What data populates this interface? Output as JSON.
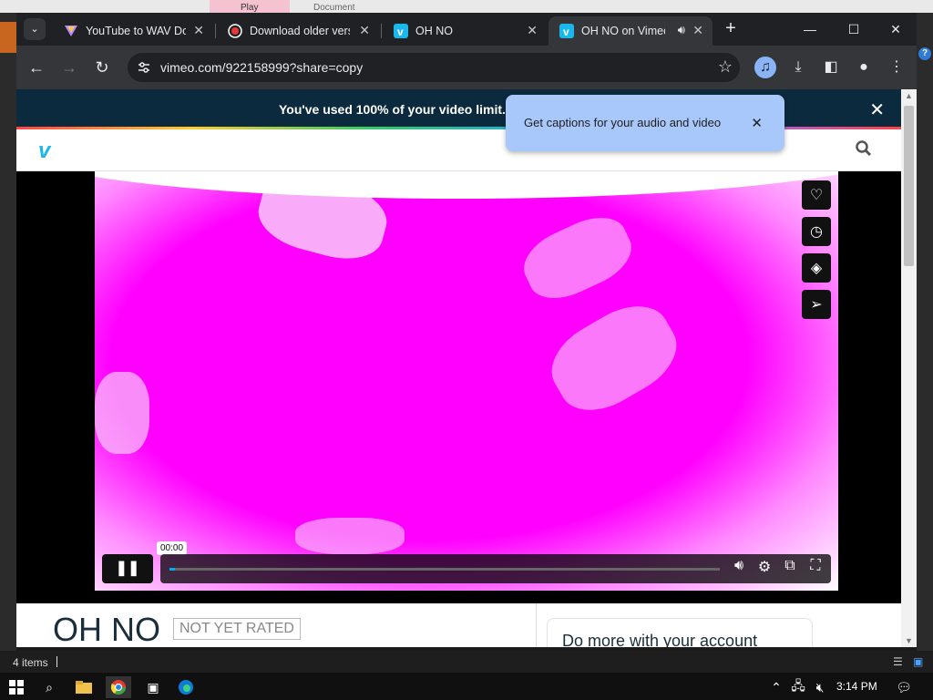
{
  "desktop": {
    "bg_label_1": "Play",
    "bg_label_2": "Document"
  },
  "tabs": [
    {
      "title": "YouTube to WAV Dow",
      "icon": "triangle-logo-icon"
    },
    {
      "title": "Download older vers",
      "icon": "record-icon"
    },
    {
      "title": "OH NO",
      "icon": "vimeo-icon"
    },
    {
      "title": "OH NO on Vimeo",
      "icon": "vimeo-icon",
      "active": true
    }
  ],
  "tab_search_label": "⌄",
  "new_tab_label": "+",
  "window_controls": {
    "minimize": "—",
    "maximize": "☐",
    "close": "✕"
  },
  "toolbar": {
    "url": "vimeo.com/922158999?share=copy",
    "back": "←",
    "forward": "→",
    "reload": "↻"
  },
  "banner": {
    "text": "You've used 100% of your video limit.",
    "close": "✕"
  },
  "captions_popup": {
    "text": "Get captions for your audio and video",
    "close": "✕"
  },
  "vimeo": {
    "logo": "v",
    "search": "⌕"
  },
  "player": {
    "timecode": "00:00",
    "progress": 0.01,
    "play_pause": "❚❚"
  },
  "video_info": {
    "title": "OH NO",
    "rating": "NOT YET RATED",
    "account_title": "Do more with your account"
  },
  "statusbar": {
    "items": "4 items"
  },
  "taskbar": {
    "time": "3:14 PM"
  },
  "colors": {
    "accent": "#1ab7ea",
    "banner": "#0b2a3d",
    "popup": "#a8c7fa",
    "video": "#ff00ff"
  }
}
